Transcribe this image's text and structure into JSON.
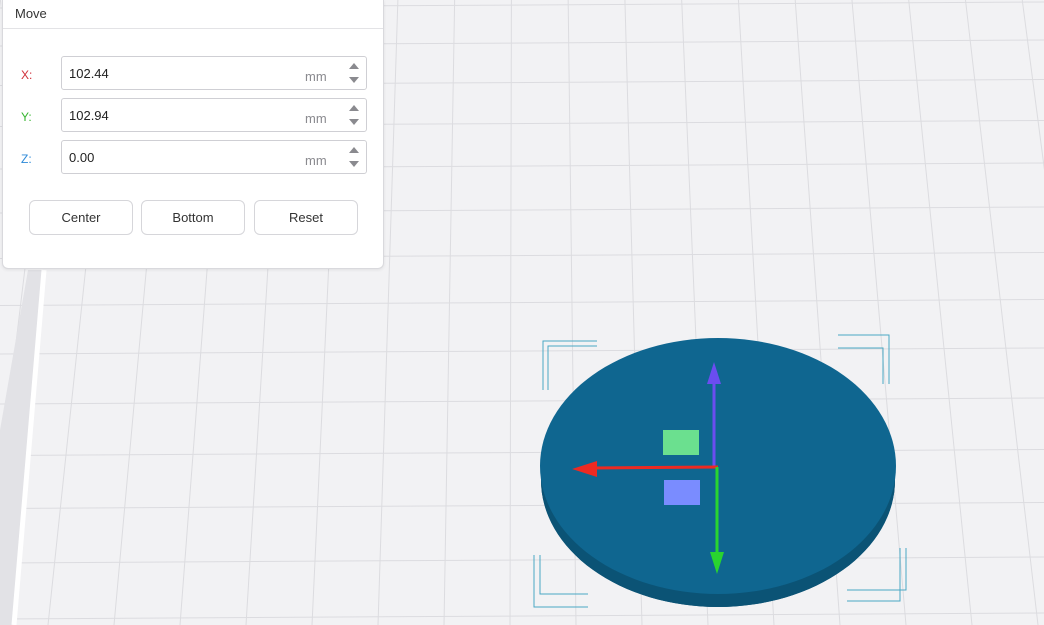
{
  "move_panel": {
    "title": "Move",
    "fields": [
      {
        "axis_label": "X:",
        "value": "102.44",
        "unit": "mm",
        "color": "#d0303a"
      },
      {
        "axis_label": "Y:",
        "value": "102.94",
        "unit": "mm",
        "color": "#36b52f"
      },
      {
        "axis_label": "Z:",
        "value": "0.00",
        "unit": "mm",
        "color": "#2e8ad8"
      }
    ],
    "buttons": {
      "center": "Center",
      "bottom": "Bottom",
      "reset": "Reset"
    }
  },
  "scene": {
    "object_color": "#0f6690",
    "object_edge_color": "#0b5375",
    "gizmo": {
      "x_axis_color": "#ee2a22",
      "y_axis_color": "#29d42f",
      "z_axis_color": "#6b4df0",
      "xy_plane_color": "#6be08f",
      "xz_plane_color": "#7a8cff"
    },
    "selection_bracket_color": "#4aa8c4"
  }
}
